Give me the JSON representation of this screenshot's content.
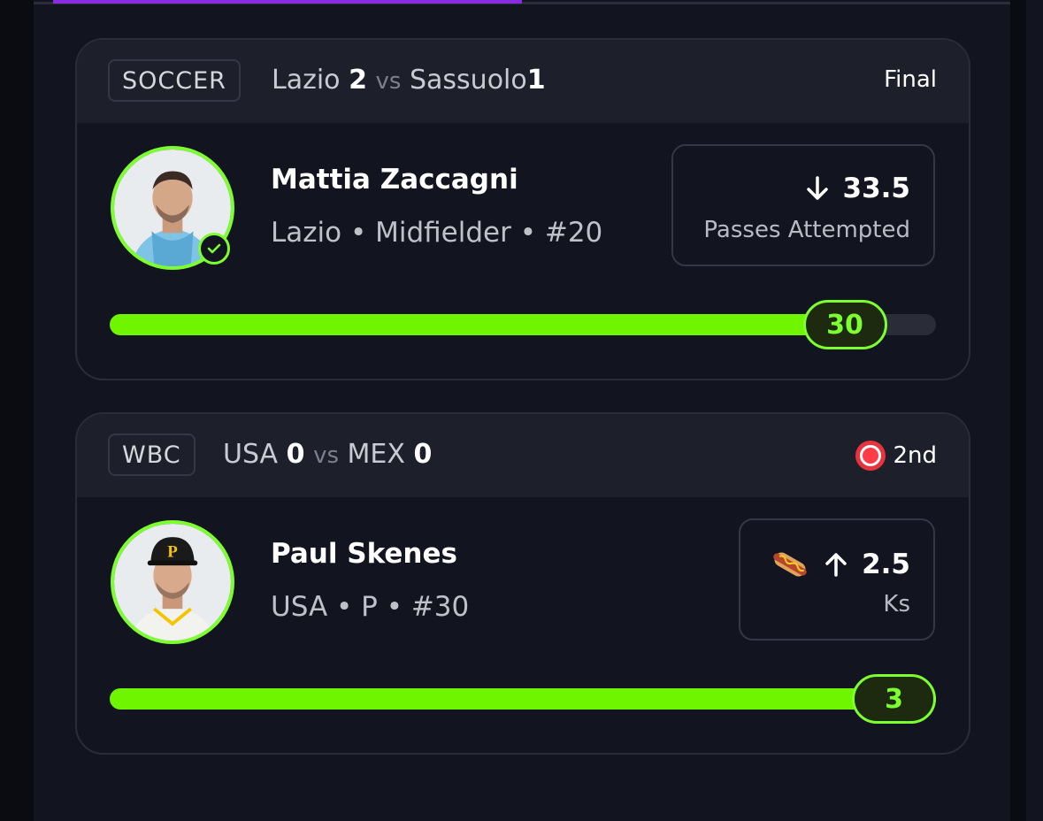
{
  "colors": {
    "accent_green": "#7dff2f",
    "live_red": "#e8333f",
    "top_accent": "#8a2be2"
  },
  "cards": [
    {
      "sport": "SOCCER",
      "home_team": "Lazio",
      "home_score": "2",
      "vs": "vs",
      "away_team": "Sassuolo",
      "away_score": "1",
      "status": "Final",
      "player_name": "Mattia Zaccagni",
      "player_meta": "Lazio • Midfielder • #20",
      "line_value": "33.5",
      "direction": "down",
      "stat_label": "Passes Attempted",
      "actual_value": "30",
      "progress": 0.9,
      "checked": true,
      "icon": "arrow-down-icon"
    },
    {
      "sport": "WBC",
      "home_team": "USA",
      "home_score": "0",
      "vs": "vs",
      "away_team": "MEX",
      "away_score": "0",
      "status": "2nd",
      "live": true,
      "player_name": "Paul Skenes",
      "player_meta": "USA • P • #30",
      "line_value": "2.5",
      "direction": "up",
      "stat_label": "Ks",
      "actual_value": "3",
      "progress": 1.0,
      "icon": "arrow-up-icon",
      "emoji_icon": "hotdog-icon"
    }
  ]
}
